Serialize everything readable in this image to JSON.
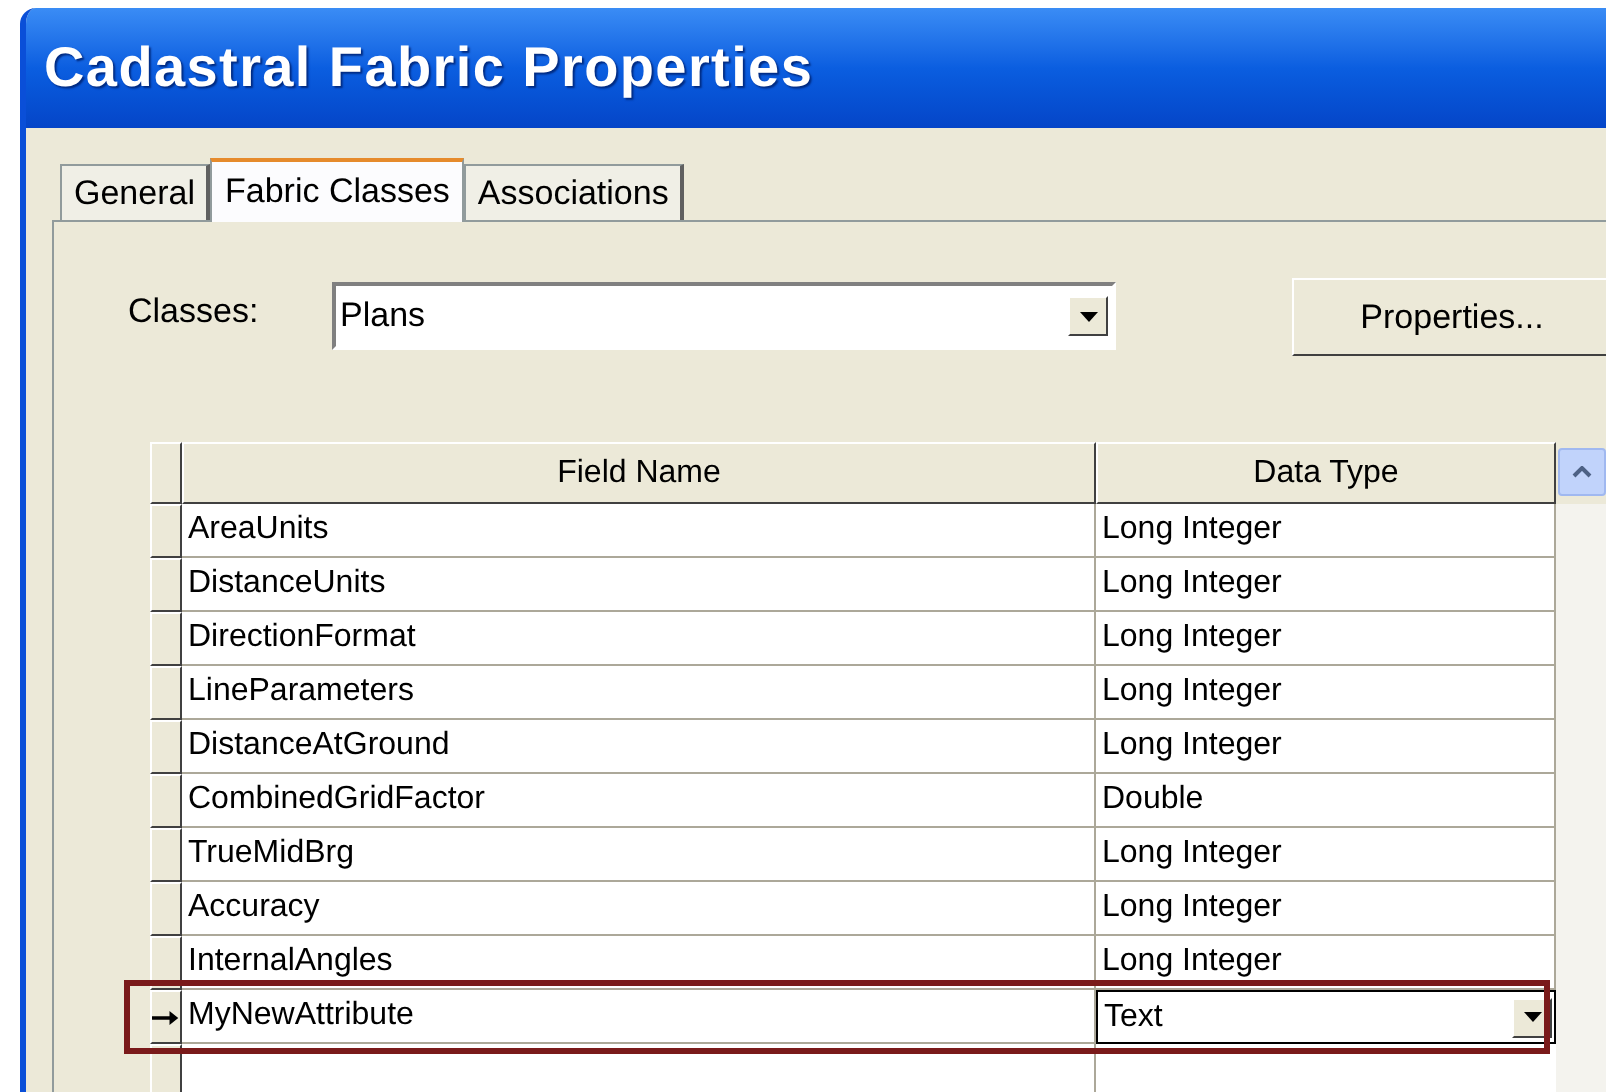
{
  "window": {
    "title": "Cadastral Fabric Properties"
  },
  "tabs": [
    {
      "label": "General",
      "selected": false
    },
    {
      "label": "Fabric Classes",
      "selected": true
    },
    {
      "label": "Associations",
      "selected": false
    }
  ],
  "classes": {
    "label": "Classes:",
    "value": "Plans"
  },
  "properties_button": "Properties...",
  "table": {
    "columns": [
      "Field Name",
      "Data Type"
    ],
    "rows": [
      {
        "field": "AreaUnits",
        "type": "Long Integer",
        "selected": false,
        "highlighted": false
      },
      {
        "field": "DistanceUnits",
        "type": "Long Integer",
        "selected": false,
        "highlighted": false
      },
      {
        "field": "DirectionFormat",
        "type": "Long Integer",
        "selected": false,
        "highlighted": false
      },
      {
        "field": "LineParameters",
        "type": "Long Integer",
        "selected": false,
        "highlighted": false
      },
      {
        "field": "DistanceAtGround",
        "type": "Long Integer",
        "selected": false,
        "highlighted": false
      },
      {
        "field": "CombinedGridFactor",
        "type": "Double",
        "selected": false,
        "highlighted": false
      },
      {
        "field": "TrueMidBrg",
        "type": "Long Integer",
        "selected": false,
        "highlighted": false
      },
      {
        "field": "Accuracy",
        "type": "Long Integer",
        "selected": false,
        "highlighted": false
      },
      {
        "field": "InternalAngles",
        "type": "Long Integer",
        "selected": false,
        "highlighted": false
      },
      {
        "field": "MyNewAttribute",
        "type": "Text",
        "selected": true,
        "highlighted": true
      }
    ]
  }
}
